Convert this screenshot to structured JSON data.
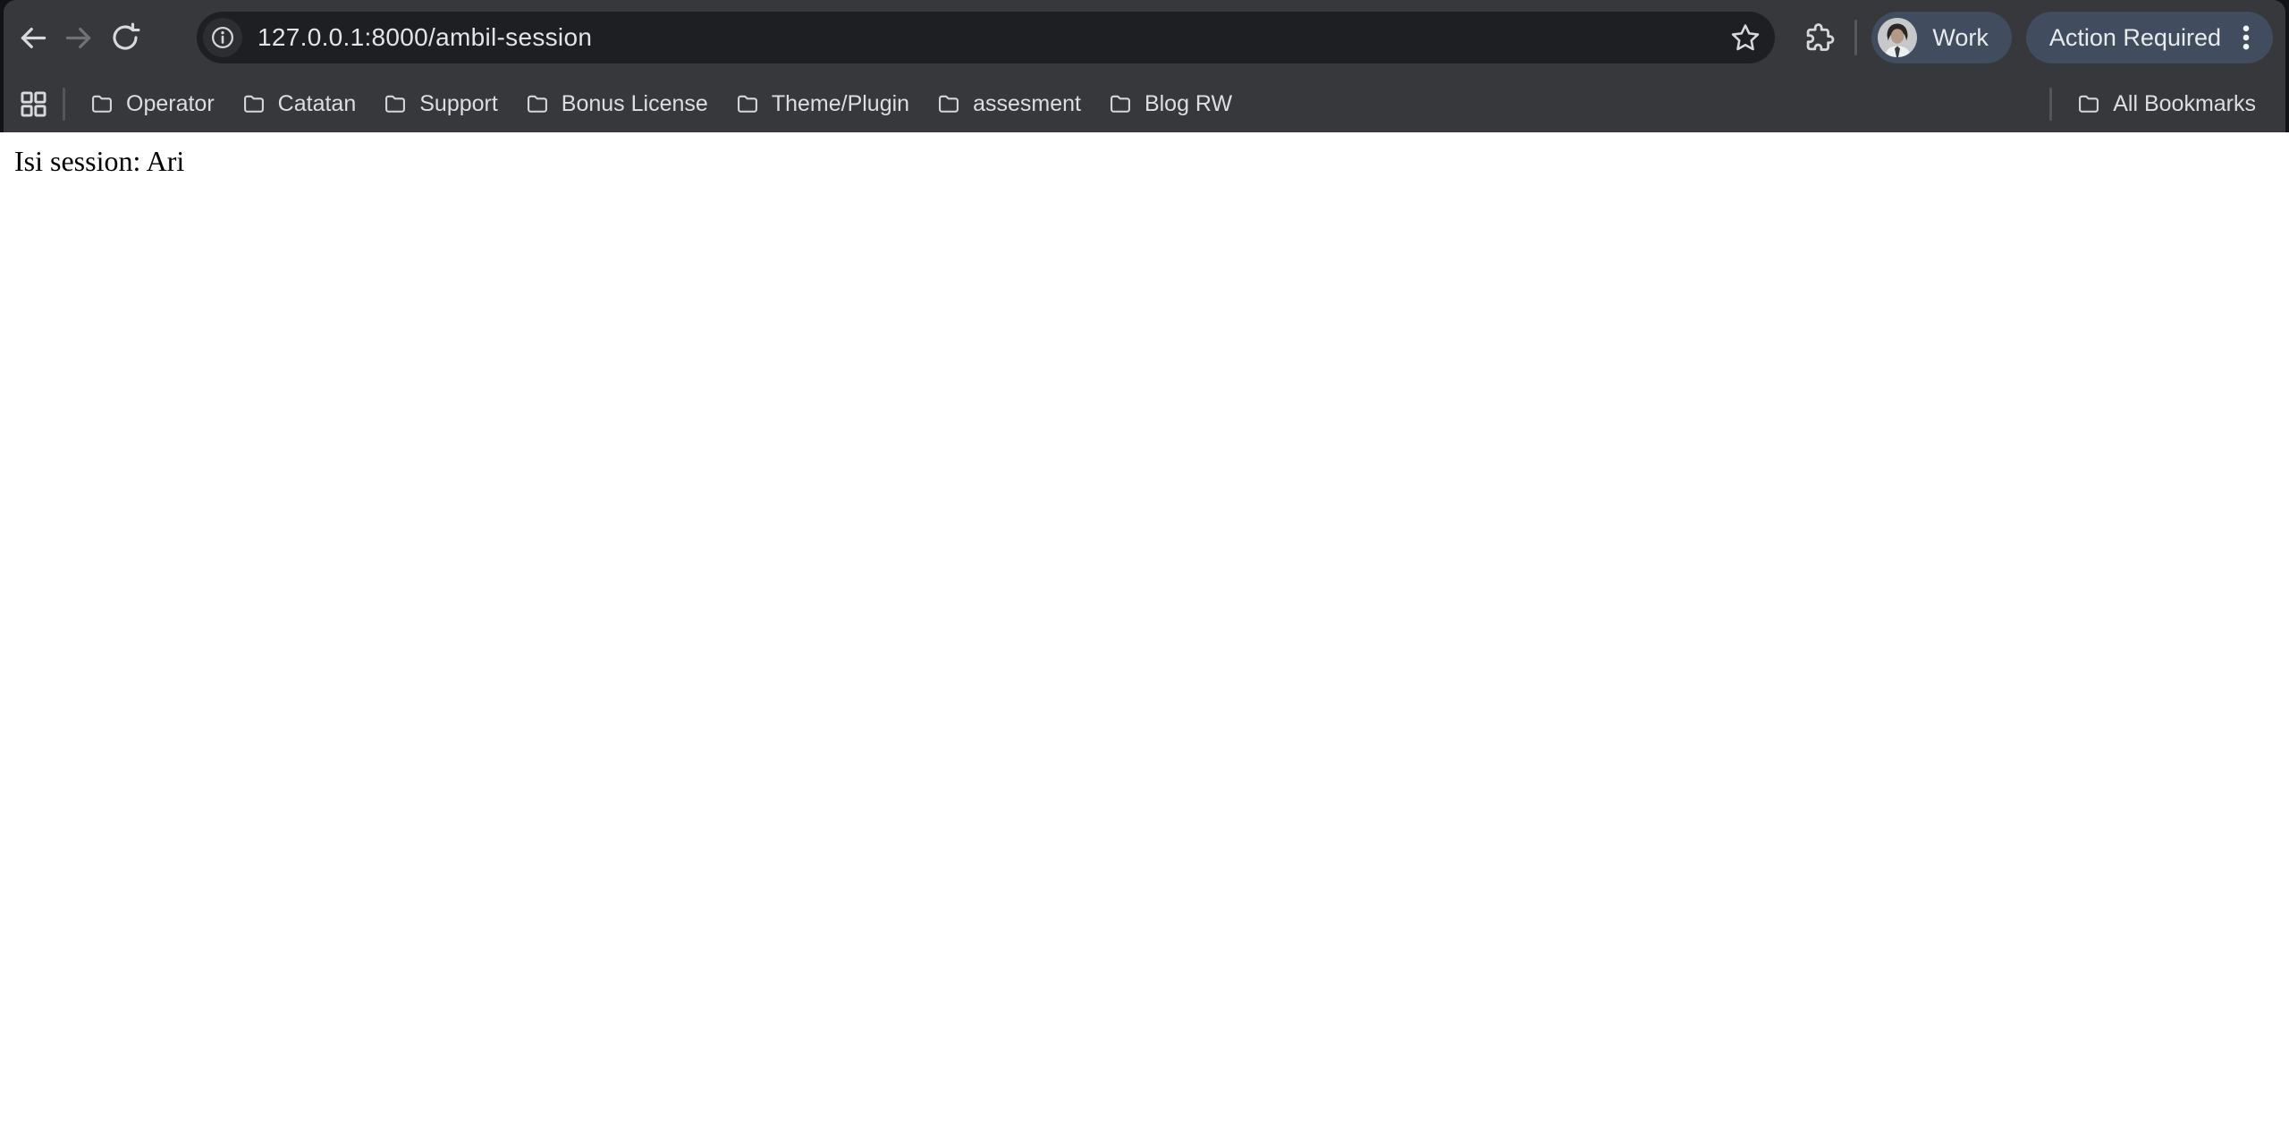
{
  "toolbar": {
    "url": "127.0.0.1:8000/ambil-session",
    "profile": {
      "label": "Work"
    },
    "action_button": {
      "label": "Action Required"
    }
  },
  "bookmarks_bar": {
    "items": [
      {
        "label": "Operator"
      },
      {
        "label": "Catatan"
      },
      {
        "label": "Support"
      },
      {
        "label": "Bonus License"
      },
      {
        "label": "Theme/Plugin"
      },
      {
        "label": "assesment"
      },
      {
        "label": "Blog RW"
      }
    ],
    "all_bookmarks": {
      "label": "All Bookmarks"
    }
  },
  "page": {
    "body_text": "Isi session: Ari"
  },
  "icons": {
    "back": "back-icon",
    "forward": "forward-icon",
    "reload": "reload-icon",
    "site_info": "site-info-icon",
    "bookmark_star": "bookmark-star-icon",
    "extensions": "extensions-puzzle-icon",
    "more_menu": "more-vert-icon",
    "apps": "apps-grid-icon",
    "bookmark_folder": "folder-icon"
  },
  "colors": {
    "frame_bg": "#121316",
    "chrome_bg": "#37383c",
    "omnibox_bg": "#1e1f23",
    "pill_bg": "#414d5e",
    "toolbar_text": "#e2e4e8",
    "bookmark_text": "#dcdfe2",
    "page_bg": "#ffffff",
    "page_text": "#000000"
  }
}
